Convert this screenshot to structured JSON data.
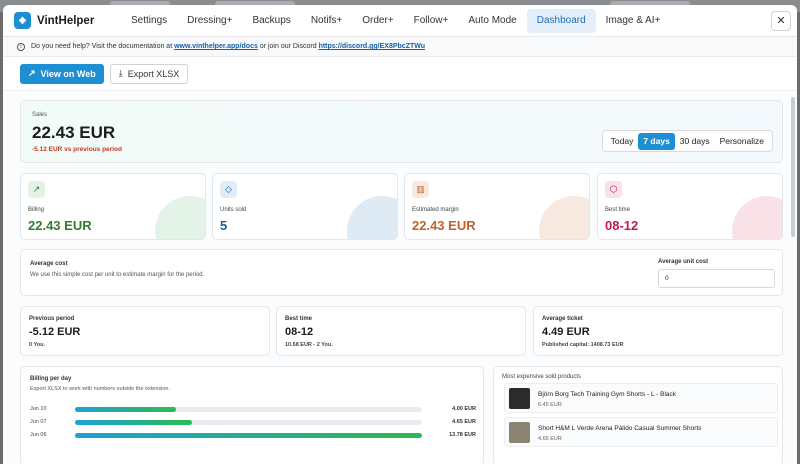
{
  "app": {
    "title": "VintHelper"
  },
  "nav": [
    {
      "label": "Settings",
      "active": false
    },
    {
      "label": "Dressing+",
      "active": false
    },
    {
      "label": "Backups",
      "active": false
    },
    {
      "label": "Notifs+",
      "active": false
    },
    {
      "label": "Order+",
      "active": false
    },
    {
      "label": "Follow+",
      "active": false
    },
    {
      "label": "Auto Mode",
      "active": false
    },
    {
      "label": "Dashboard",
      "active": true
    },
    {
      "label": "Image & AI+",
      "active": false
    }
  ],
  "close_label": "✕",
  "help": {
    "text1": "Do you need help? Visit the documentation at",
    "docs_link": "www.vinthelper.app/docs",
    "text2": "or join our Discord",
    "discord_link": "https://discord.gg/EX8PbcZTWu"
  },
  "actions": {
    "view_web": "View on Web",
    "export": "Export XLSX"
  },
  "sales": {
    "label": "Sales",
    "amount": "22.43 EUR",
    "delta": "-5.12 EUR vs previous period",
    "ranges": [
      {
        "label": "Today",
        "selected": false
      },
      {
        "label": "7 days",
        "selected": true
      },
      {
        "label": "30 days",
        "selected": false
      },
      {
        "label": "Personalize",
        "selected": false
      }
    ]
  },
  "metrics": [
    {
      "icon": "trend-up-icon",
      "label": "Billing",
      "value": "22.43 EUR",
      "color": "#2e7d32"
    },
    {
      "icon": "tag-icon",
      "label": "Units sold",
      "value": "5",
      "color": "#1a5fa8"
    },
    {
      "icon": "bar-chart-icon",
      "label": "Estimated margin",
      "value": "22.43 EUR",
      "color": "#c0622a"
    },
    {
      "icon": "box-icon",
      "label": "Best time",
      "value": "08-12",
      "color": "#c2185b"
    }
  ],
  "average_cost": {
    "title": "Average cost",
    "subtitle": "We use this simple cost per unit to estimate margin for the period.",
    "field_label": "Average unit cost",
    "field_value": "0"
  },
  "summary": [
    {
      "title": "Previous period",
      "value": "-5.12 EUR",
      "sub": "0 You."
    },
    {
      "title": "Best time",
      "value": "08-12",
      "sub": "10.58 EUR - 2 You."
    },
    {
      "title": "Average ticket",
      "value": "4.49 EUR",
      "sub": "Published capital: 1408.73 EUR"
    }
  ],
  "billing_per_day": {
    "title": "Billing per day",
    "subtitle": "Export XLSX to work with numbers outside the extension.",
    "rows": [
      {
        "date": "Jun 10",
        "value": "4.00 EUR",
        "fraction": 0.29
      },
      {
        "date": "Jun 07",
        "value": "4.65 EUR",
        "fraction": 0.337
      },
      {
        "date": "Jun 06",
        "value": "13.78 EUR",
        "fraction": 1.0
      }
    ]
  },
  "expensive": {
    "title": "Most expensive sold products",
    "products": [
      {
        "name": "Björn Borg Tech Training Gym Shorts - L - Black",
        "price": "6.45 EUR",
        "thumb_color": "#2b2b2b"
      },
      {
        "name": "Short H&M L Verde Arena Pálido Casual Summer Shorts",
        "price": "4.65 EUR",
        "thumb_color": "#8a8470"
      }
    ]
  }
}
